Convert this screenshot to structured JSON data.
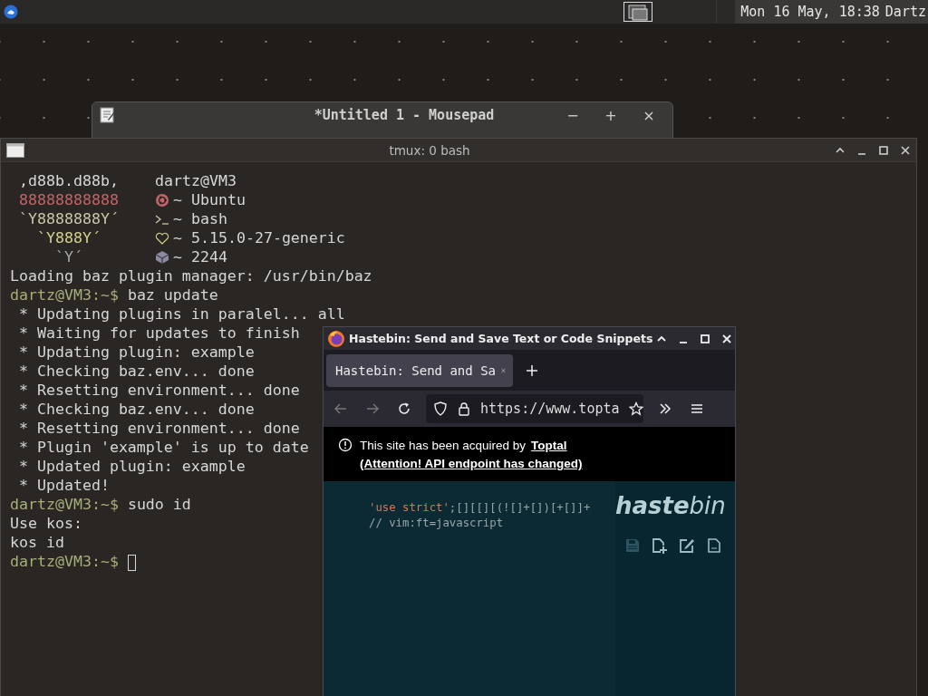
{
  "top_panel": {
    "clock": "Mon 16 May, 18:38",
    "user": "Dartz"
  },
  "mousepad": {
    "title": "*Untitled 1 - Mousepad",
    "controls": [
      "−",
      "+",
      "×"
    ]
  },
  "terminal": {
    "title": "tmux: 0 bash",
    "ascii": [
      {
        "text": " ,d88b.d88b,",
        "color": "#d8d8d8"
      },
      {
        "text": " 88888888888",
        "color": "#c0666a"
      },
      {
        "text": " `Y8888888Y´",
        "color": "#c8c8a8"
      },
      {
        "text": "   `Y888Y´",
        "color": "#d2d28c"
      },
      {
        "text": "     `Y´",
        "color": "#a8a8a8"
      }
    ],
    "user_host": "dartz@VM3",
    "info": [
      {
        "kind": "os",
        "text": "~ Ubuntu"
      },
      {
        "kind": "shell",
        "text": "~ bash"
      },
      {
        "kind": "kernel",
        "text": "~ 5.15.0-27-generic"
      },
      {
        "kind": "packages",
        "text": "~ 2244"
      }
    ],
    "lines": [
      {
        "kind": "output",
        "text": "Loading baz plugin manager: /usr/bin/baz"
      },
      {
        "kind": "prompt",
        "prompt": "dartz@VM3:~$",
        "text": "baz update"
      },
      {
        "kind": "output",
        "text": " * Updating plugins in paralel... all"
      },
      {
        "kind": "output",
        "text": " * Waiting for updates to finish"
      },
      {
        "kind": "output",
        "text": " * Updating plugin: example"
      },
      {
        "kind": "output",
        "text": " * Checking baz.env... done"
      },
      {
        "kind": "output",
        "text": " * Resetting environment... done"
      },
      {
        "kind": "output",
        "text": " * Checking baz.env... done"
      },
      {
        "kind": "output",
        "text": " * Resetting environment... done"
      },
      {
        "kind": "output",
        "text": " * Plugin 'example' is up to date"
      },
      {
        "kind": "output",
        "text": " * Updated plugin: example"
      },
      {
        "kind": "output",
        "text": " * Updated!"
      },
      {
        "kind": "prompt",
        "prompt": "dartz@VM3:~$",
        "text": "sudo id"
      },
      {
        "kind": "output",
        "text": "Use kos:"
      },
      {
        "kind": "output",
        "text": "kos id"
      },
      {
        "kind": "cursor_prompt",
        "prompt": "dartz@VM3:~$"
      }
    ]
  },
  "browser": {
    "title": "Hastebin: Send and Save Text or Code Snippets",
    "tabs": [
      {
        "label": "Hastebin: Send and Sa",
        "selected": true
      }
    ],
    "url": "https://www.topta",
    "notice": {
      "text": "This site has been acquired by",
      "link": "Toptal",
      "link2": "(Attention! API endpoint has changed)"
    },
    "code": [
      {
        "kind": "strict",
        "text": "'use strict'",
        "rest": ";[][[][(![]+[])[+[]]+"
      },
      {
        "kind": "comment",
        "text": "// vim:ft=javascript"
      }
    ],
    "logo": "**haste**bin",
    "tools": [
      {
        "kind": "save",
        "disabled": true
      },
      {
        "kind": "new",
        "disabled": false
      },
      {
        "kind": "edit",
        "disabled": false
      },
      {
        "kind": "raw",
        "disabled": false
      }
    ]
  }
}
